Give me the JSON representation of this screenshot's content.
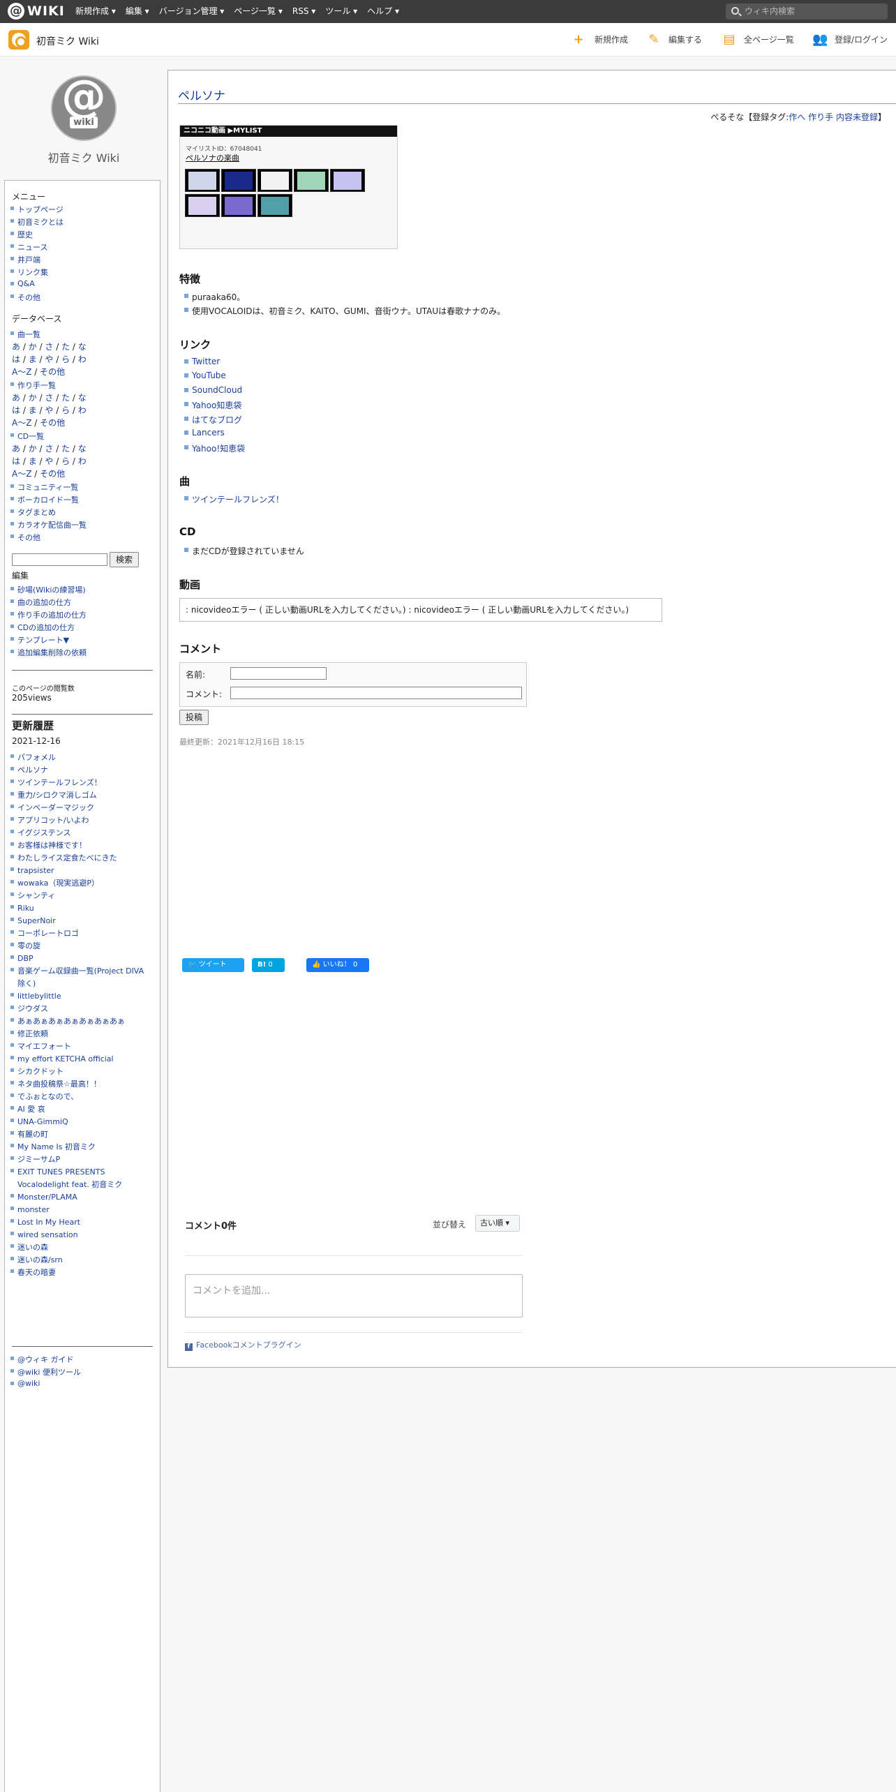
{
  "topbar": {
    "logo": "WIKI",
    "menu": [
      "新規作成 ▾",
      "編集 ▾",
      "バージョン管理 ▾",
      "ページ一覧 ▾",
      "RSS ▾",
      "ツール ▾",
      "ヘルプ ▾"
    ],
    "search_placeholder": "ウィキ内検索"
  },
  "header": {
    "site_title": "初音ミク Wiki",
    "actions": [
      "新規作成",
      "編集する",
      "全ページ一覧",
      "登録/ログイン"
    ]
  },
  "sidebar": {
    "avatar_text": "wiki",
    "title": "初音ミク Wiki",
    "menu_heading": "メニュー",
    "menu_items": [
      "トップページ",
      "初音ミクとは",
      "歴史",
      "ニュース",
      "井戸端",
      "リンク集",
      "Q&A",
      "その他"
    ],
    "db_heading": "データベース",
    "song_list": "曲一覧",
    "kana_rows": [
      [
        "あ",
        "か",
        "さ",
        "た",
        "な"
      ],
      [
        "は",
        "ま",
        "や",
        "ら",
        "わ"
      ],
      [
        "A～Z",
        "その他"
      ]
    ],
    "author_list": "作り手一覧",
    "cd_list": "CD一覧",
    "db_items": [
      "コミュニティ一覧",
      "ボーカロイド一覧",
      "タグまとめ",
      "カラオケ配信曲一覧",
      "その他"
    ],
    "search_button": "検索",
    "edit_heading": "編集",
    "edit_items": [
      "砂場(Wikiの練習場)",
      "曲の追加の仕方",
      "作り手の追加の仕方",
      "CDの追加の仕方",
      "テンプレート▼",
      "追加編集削除の依頼"
    ],
    "views_label": "このページの閲覧数",
    "views_value": "205views",
    "history_heading": "更新履歴",
    "history_date": "2021-12-16",
    "history_items": [
      "パフォメル",
      "ペルソナ",
      "ツインテールフレンズ！",
      "重力/シロクマ消しゴム",
      "インベーダーマジック",
      "アプリコット/いよわ",
      "イグジステンス",
      "お客様は神様です！",
      "わたしライス定食たべにきた",
      "trapsister",
      "wowaka（現実逃避P）",
      "シャンティ",
      "Riku",
      "SuperNoir",
      "コーポレートロゴ",
      "零の旋",
      "DBP",
      "音楽ゲーム収録曲一覧(Project DIVA除く)",
      "littlebylittle",
      "ジウダス",
      "あぁあぁあぁあぁあぁあぁあぁ",
      "修正依頼",
      "マイエフォート",
      "my effort KETCHA official",
      "シカクドット",
      "ネタ曲投稿祭☆最高！！",
      "でふぉとなので、",
      "AI 愛 哀",
      "UNA-GimmiQ",
      "有麗の町",
      "My Name Is 初音ミク",
      "ジミーサムP",
      "EXIT TUNES PRESENTS Vocalodelight feat. 初音ミク",
      "Monster/PLAMA",
      "monster",
      "Lost In My Heart",
      "wired sensation",
      "迷いの森",
      "迷いの森/srn",
      "春天の暗妻"
    ],
    "footer_items": [
      "@ウィキ ガイド",
      "@wiki 便利ツール",
      "@wiki"
    ]
  },
  "main": {
    "page_title": "ペルソナ",
    "tagline_prefix": "ぺるそな【登録タグ:",
    "tags": [
      "作へ",
      "作り手",
      "内容未登録"
    ],
    "tagline_suffix": "】",
    "nico_header": "ニコニコ動画 ▶MYLIST",
    "mylist_id": "マイリストID：67048041",
    "mylist_name": "ペルソナの楽曲",
    "h_features": "特徴",
    "features": [
      "puraaka60。",
      "使用VOCALOIDは、初音ミク、KAITO、GUMI、音街ウナ。UTAUは春歌ナナのみ。"
    ],
    "h_links": "リンク",
    "links": [
      "Twitter",
      "YouTube",
      "SoundCloud",
      "Yahoo知恵袋",
      "はてなブログ",
      "Lancers",
      "Yahoo!知恵袋"
    ],
    "h_songs": "曲",
    "songs": [
      "ツインテールフレンズ！"
    ],
    "h_cd": "CD",
    "cd_items": [
      "まだCDが登録されていません"
    ],
    "h_video": "動画",
    "video_error": ": nicovideoエラー ( 正しい動画URLを入力してください。) : nicovideoエラー ( 正しい動画URLを入力してください。)",
    "h_comment": "コメント",
    "name_label": "名前:",
    "comment_label": "コメント:",
    "post_button": "投稿",
    "last_updated": "最終更新：2021年12月16日 18:15",
    "tweet": "ツイート",
    "hatena_label": "B!",
    "hatena_count": "0",
    "like_label": "いいね！",
    "like_count": "0",
    "fb_comment_count": "コメント0件",
    "sort_label": "並び替え",
    "sort_value": "古い順 ▾",
    "fb_placeholder": "コメントを追加...",
    "fb_plugin": "Facebookコメントプラグイン"
  },
  "colors": {
    "topbar": "#3b3b3b",
    "accent": "#f0a020",
    "link": "#1a3f9c",
    "bullet": "#7aa3d8"
  }
}
